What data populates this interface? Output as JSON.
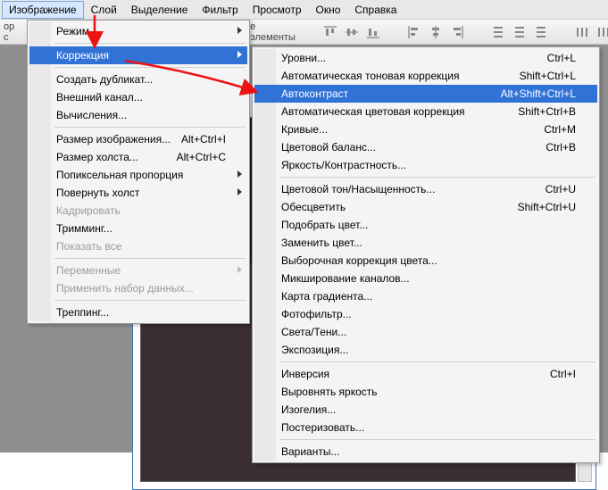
{
  "menubar": {
    "items": [
      {
        "label": "Изображение",
        "active": true
      },
      {
        "label": "Слой"
      },
      {
        "label": "Выделение"
      },
      {
        "label": "Фильтр"
      },
      {
        "label": "Просмотр"
      },
      {
        "label": "Окно"
      },
      {
        "label": "Справка"
      }
    ]
  },
  "toolbar": {
    "left_truncated": "ор с",
    "mid_truncated": "е элементы"
  },
  "image_menu": {
    "mode": "Режим",
    "correction": "Коррекция",
    "duplicate": "Создать дубликат...",
    "apply_image": "Внешний канал...",
    "calculations": "Вычисления...",
    "image_size": "Размер изображения...",
    "image_size_sc": "Alt+Ctrl+I",
    "canvas_size": "Размер холста...",
    "canvas_size_sc": "Alt+Ctrl+C",
    "pixel_ar": "Попиксельная пропорция",
    "rotate": "Повернуть холст",
    "crop": "Кадрировать",
    "trim": "Тримминг...",
    "reveal_all": "Показать все",
    "variables": "Переменные",
    "apply_dataset": "Применить набор данных...",
    "trap": "Треппинг..."
  },
  "correction_menu": {
    "levels": "Уровни...",
    "levels_sc": "Ctrl+L",
    "auto_levels": "Автоматическая тоновая коррекция",
    "auto_levels_sc": "Shift+Ctrl+L",
    "auto_contrast": "Автоконтраст",
    "auto_contrast_sc": "Alt+Shift+Ctrl+L",
    "auto_color": "Автоматическая цветовая коррекция",
    "auto_color_sc": "Shift+Ctrl+B",
    "curves": "Кривые...",
    "curves_sc": "Ctrl+M",
    "color_balance": "Цветовой баланс...",
    "color_balance_sc": "Ctrl+B",
    "brightness": "Яркость/Контрастность...",
    "hue": "Цветовой тон/Насыщенность...",
    "hue_sc": "Ctrl+U",
    "desaturate": "Обесцветить",
    "desaturate_sc": "Shift+Ctrl+U",
    "match_color": "Подобрать цвет...",
    "replace_color": "Заменить цвет...",
    "selective": "Выборочная коррекция цвета...",
    "channel_mixer": "Микширование каналов...",
    "gradient_map": "Карта градиента...",
    "photo_filter": "Фотофильтр...",
    "shadow_highlight": "Света/Тени...",
    "exposure": "Экспозиция...",
    "invert": "Инверсия",
    "invert_sc": "Ctrl+I",
    "equalize": "Выровнять яркость",
    "threshold": "Изогелия...",
    "posterize": "Постеризовать...",
    "variations": "Варианты..."
  }
}
